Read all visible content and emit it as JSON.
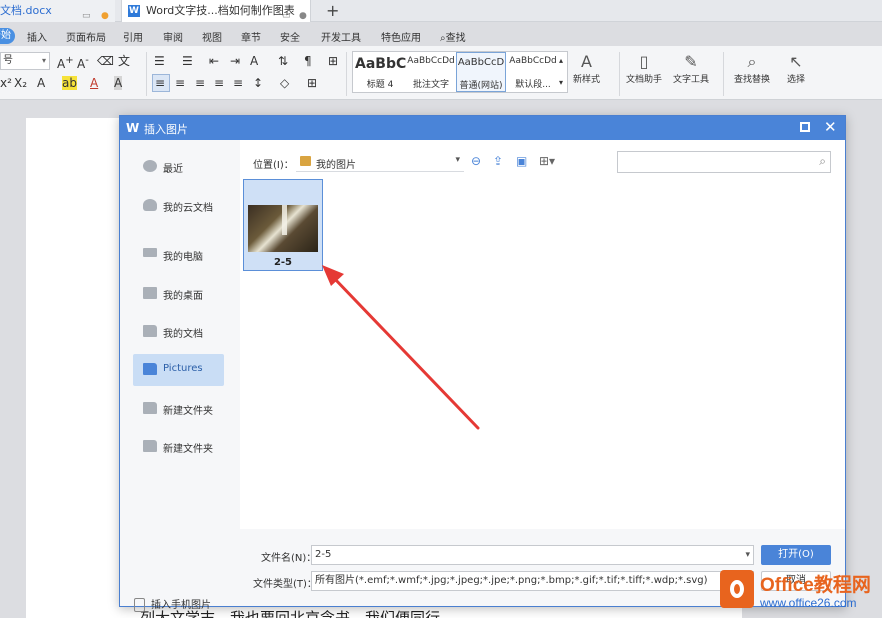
{
  "tabs": [
    {
      "label": "文档.docx"
    },
    {
      "label": "Word文字技...档如何制作图表"
    }
  ],
  "tab_new": "+",
  "menu": [
    "开始",
    "插入",
    "页面布局",
    "引用",
    "审阅",
    "视图",
    "章节",
    "安全",
    "开发工具",
    "特色应用"
  ],
  "menu_search": "查找",
  "ribbon": {
    "font_size": "号",
    "styles": [
      {
        "preview": "AaBbC",
        "caption": "标题 4"
      },
      {
        "preview": "AaBbCcDd",
        "caption": "批注文字"
      },
      {
        "preview": "AaBbCcD",
        "caption": "普通(网站)"
      },
      {
        "preview": "AaBbCcDd",
        "caption": "默认段..."
      }
    ],
    "tools": [
      "新样式",
      "文档助手",
      "文字工具",
      "查找替换",
      "选择"
    ]
  },
  "dialog": {
    "title": "插入图片",
    "sidebar": [
      {
        "label": "最近",
        "icon": "clock-icon"
      },
      {
        "label": "我的云文档",
        "icon": "cloud-icon"
      },
      {
        "label": "我的电脑",
        "icon": "computer-icon"
      },
      {
        "label": "我的桌面",
        "icon": "desktop-icon"
      },
      {
        "label": "我的文档",
        "icon": "folder-icon"
      },
      {
        "label": "Pictures",
        "icon": "folder-icon"
      },
      {
        "label": "新建文件夹",
        "icon": "folder-icon"
      },
      {
        "label": "新建文件夹",
        "icon": "folder-icon"
      }
    ],
    "mobile_insert": "插入手机图片",
    "location_label": "位置(I)：",
    "location_value": "我的图片",
    "file": {
      "name": "2-5"
    },
    "filename_label": "文件名(N)：",
    "filename_value": "2-5",
    "filetype_label": "文件类型(T)：",
    "filetype_value": "所有图片(*.emf;*.wmf;*.jpg;*.jpeg;*.jpe;*.png;*.bmp;*.gif;*.tif;*.tiff;*.wdp;*.svg)",
    "open_button": "打开(O)",
    "cancel_button": "取消"
  },
  "document_text": "列大文学末，我也要回北京念书，我们便同行。",
  "watermark": {
    "brand": "Office教程网",
    "url": "www.office26.com"
  },
  "colors": {
    "accent": "#4a84d8",
    "arrow": "#e53935",
    "watermark_orange": "#e8641e"
  }
}
